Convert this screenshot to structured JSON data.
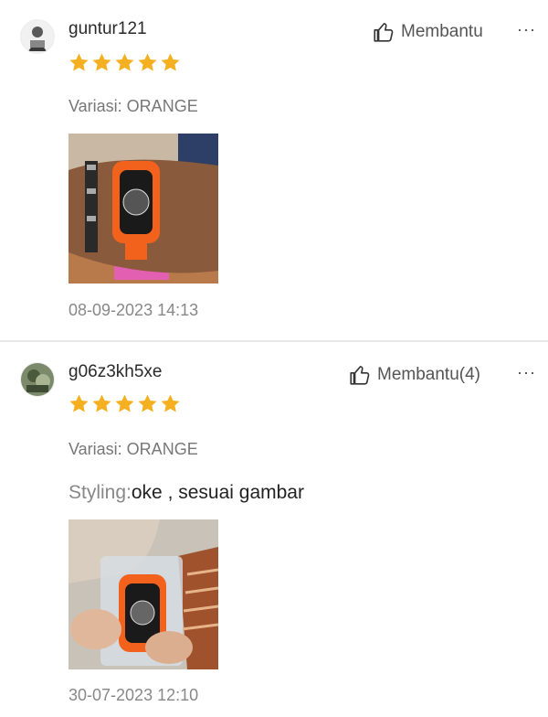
{
  "reviews": [
    {
      "username": "guntur121",
      "helpful_label": "Membantu",
      "more_label": "···",
      "rating": 5,
      "variation": "Variasi: ORANGE",
      "date": "08-09-2023 14:13",
      "avatar_icon": "user-avatar-icon",
      "photo_icon": "watch-photo"
    },
    {
      "username": "g06z3kh5xe",
      "helpful_label": "Membantu(4)",
      "more_label": "···",
      "rating": 5,
      "variation": "Variasi: ORANGE",
      "comment_label": "Styling:",
      "comment_text": "oke , sesuai gambar",
      "date": "30-07-2023 12:10",
      "avatar_icon": "user-avatar-icon",
      "photo_icon": "watch-photo"
    }
  ],
  "colors": {
    "star": "#f5b021",
    "text_muted": "#888888",
    "divider": "#e8e8e8",
    "watch_strap": "#f2621d"
  }
}
